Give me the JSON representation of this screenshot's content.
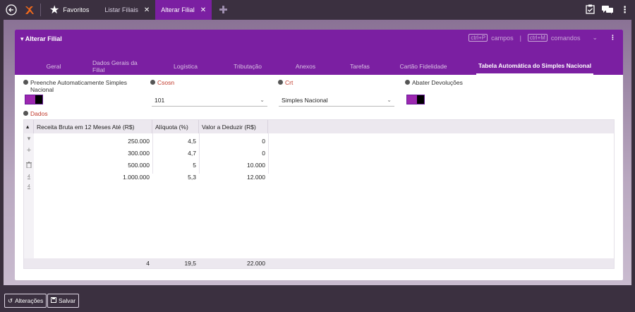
{
  "topbar": {
    "tabs": [
      {
        "label": "Favoritos"
      },
      {
        "label": "Listar Filiais"
      },
      {
        "label": "Alterar Filial"
      }
    ]
  },
  "panel": {
    "title": "Alterar Filial",
    "tools": {
      "key1": "ctrl+P",
      "label1": "campos",
      "separator": "|",
      "key2": "ctrl+M",
      "label2": "comandos"
    },
    "tabs": [
      {
        "label": "Geral"
      },
      {
        "label": "Dados Gerais da Filial"
      },
      {
        "label": "Logística"
      },
      {
        "label": "Tributação"
      },
      {
        "label": "Anexos"
      },
      {
        "label": "Tarefas"
      },
      {
        "label": "Cartão Fidelidade"
      },
      {
        "label": "Tabela Automática do Simples Nacional"
      }
    ]
  },
  "form": {
    "preenche_label": "Preenche Automaticamente Simples Nacional",
    "csosn_label": "Csosn",
    "csosn_value": "101",
    "crt_label": "Crt",
    "crt_value": "Simples Nacional",
    "abater_label": "Abater Devoluções",
    "dados_label": "Dados"
  },
  "grid": {
    "columns": [
      "Receita Bruta em 12 Meses Até (R$)",
      "Alíquota (%)",
      "Valor a Deduzir (R$)"
    ],
    "rows": [
      [
        "250.000",
        "4,5",
        "0"
      ],
      [
        "300.000",
        "4,7",
        "0"
      ],
      [
        "500.000",
        "5",
        "10.000"
      ],
      [
        "1.000.000",
        "5,3",
        "12.000"
      ]
    ],
    "footer": [
      "4",
      "19,5",
      "22.000"
    ]
  },
  "bottombar": {
    "alteracoes_label": "Alterações",
    "salvar_label": "Salvar"
  }
}
